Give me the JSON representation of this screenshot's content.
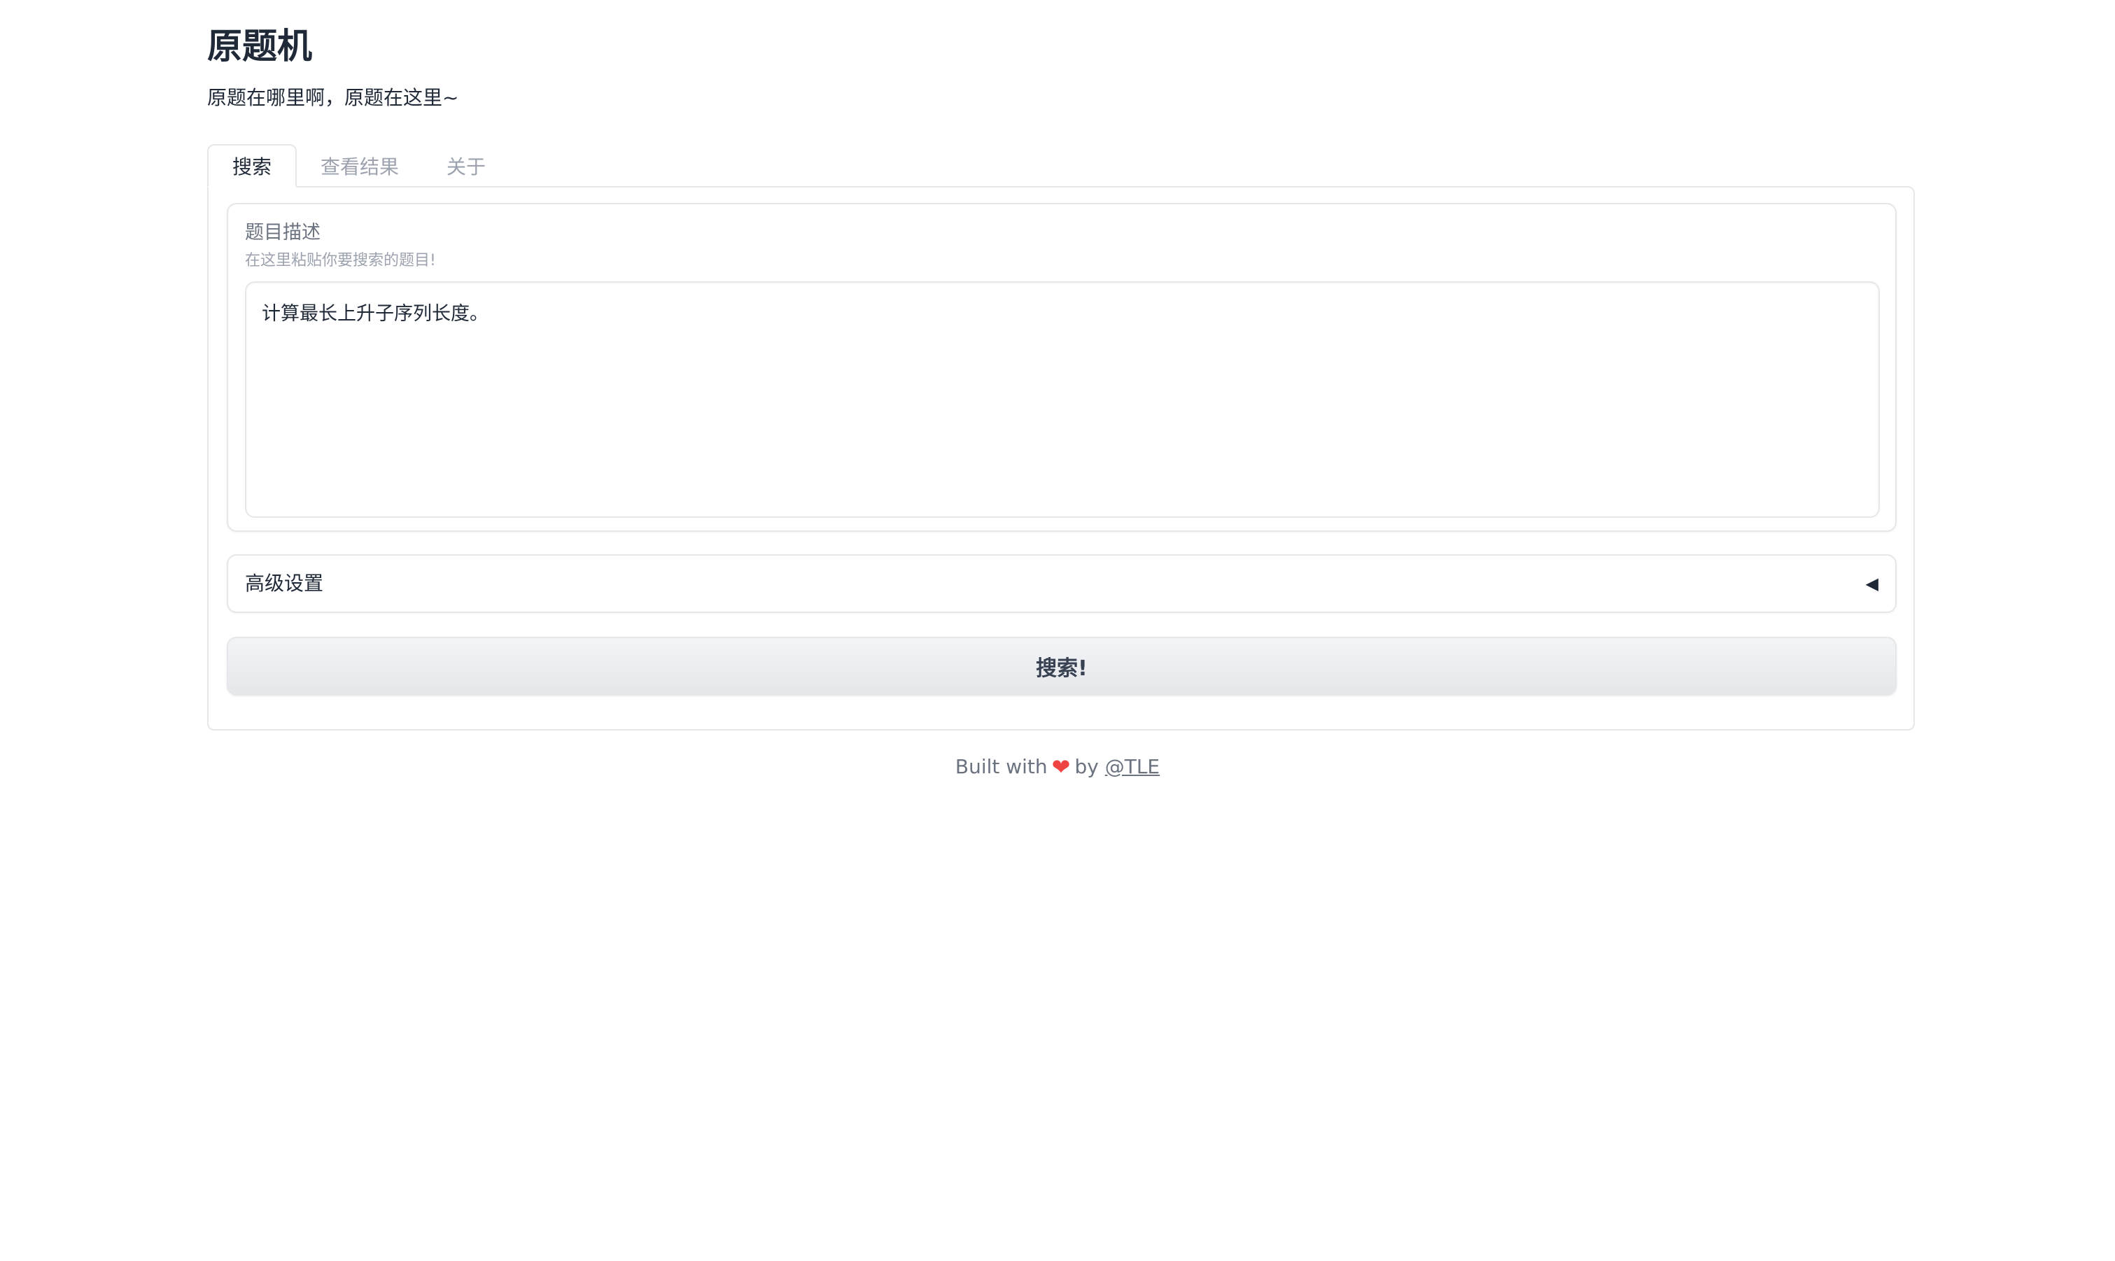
{
  "app": {
    "title": "原题机",
    "description": "原题在哪里啊，原题在这里~"
  },
  "tabs": [
    {
      "label": "搜索",
      "active": true
    },
    {
      "label": "查看结果",
      "active": false
    },
    {
      "label": "关于",
      "active": false
    }
  ],
  "search_tab": {
    "problem_field": {
      "label": "题目描述",
      "info": "在这里粘贴你要搜索的题目!",
      "value": "计算最长上升子序列长度。"
    },
    "advanced": {
      "label": "高级设置",
      "icon": "triangle-left-icon",
      "glyph": "◀",
      "expanded": false
    },
    "submit_label": "搜索!"
  },
  "footer": {
    "prefix": "Built with",
    "heart_glyph": "❤",
    "by": "by",
    "link": "@TLE"
  },
  "colors": {
    "border": "#e5e7eb",
    "text": "#1f2937",
    "muted": "#6b7280",
    "heart": "#ef4444"
  }
}
